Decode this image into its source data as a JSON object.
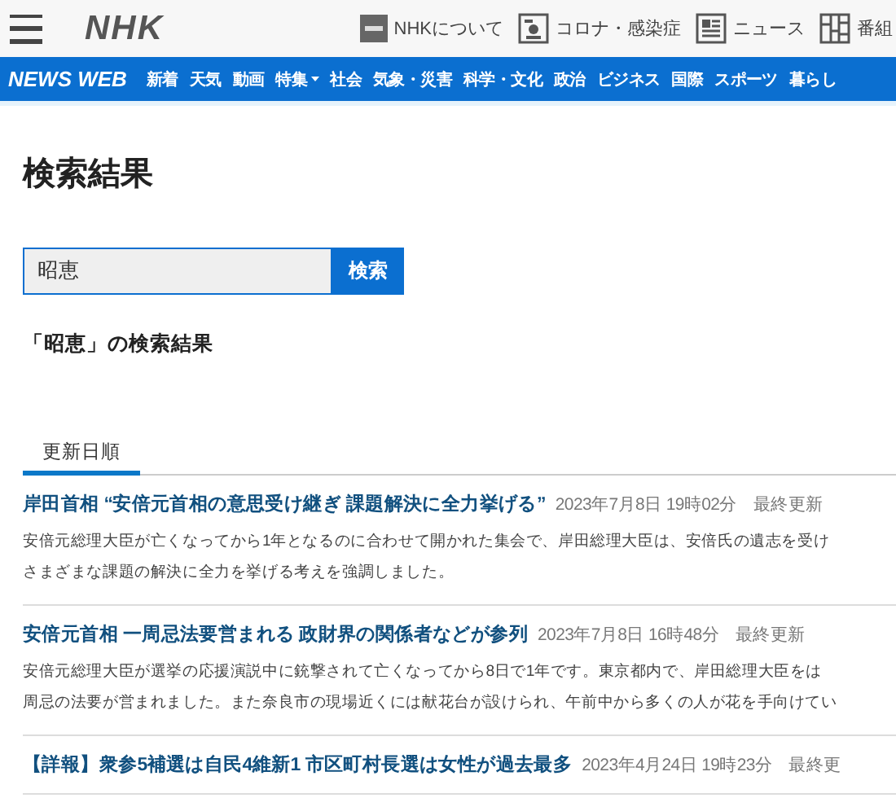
{
  "header": {
    "logo": "NHK",
    "links": [
      {
        "kind": "about",
        "label": "NHKについて"
      },
      {
        "kind": "corona",
        "label": "コロナ・感染症"
      },
      {
        "kind": "news",
        "label": "ニュース"
      },
      {
        "kind": "schedule",
        "label": "番組"
      }
    ]
  },
  "nav": {
    "brand": "NEWS WEB",
    "items": [
      {
        "label": "新着",
        "dropdown": false
      },
      {
        "label": "天気",
        "dropdown": false
      },
      {
        "label": "動画",
        "dropdown": false
      },
      {
        "label": "特集",
        "dropdown": true
      },
      {
        "label": "社会",
        "dropdown": false
      },
      {
        "label": "気象・災害",
        "dropdown": false
      },
      {
        "label": "科学・文化",
        "dropdown": false
      },
      {
        "label": "政治",
        "dropdown": false
      },
      {
        "label": "ビジネス",
        "dropdown": false
      },
      {
        "label": "国際",
        "dropdown": false
      },
      {
        "label": "スポーツ",
        "dropdown": false
      },
      {
        "label": "暮らし",
        "dropdown": false
      }
    ]
  },
  "page_title": "検索結果",
  "search": {
    "value": "昭恵",
    "button": "検索"
  },
  "results_heading": "「昭恵」の検索結果",
  "tabs": [
    {
      "label": "更新日順",
      "selected": true
    }
  ],
  "results": [
    {
      "title": "岸田首相 “安倍元首相の意思受け継ぎ 課題解決に全力挙げる”",
      "date": "2023年7月8日 19時02分",
      "note": "最終更新",
      "summary_lines": [
        "安倍元総理大臣が亡くなってから1年となるのに合わせて開かれた集会で、岸田総理大臣は、安倍氏の遺志を受け",
        "さまざまな課題の解決に全力を挙げる考えを強調しました。"
      ]
    },
    {
      "title": "安倍元首相 一周忌法要営まれる 政財界の関係者などが参列",
      "date": "2023年7月8日 16時48分",
      "note": "最終更新",
      "summary_lines": [
        "安倍元総理大臣が選挙の応援演説中に銃撃されて亡くなってから8日で1年です。東京都内で、岸田総理大臣をは",
        "周忌の法要が営まれました。また奈良市の現場近くには献花台が設けられ、午前中から多くの人が花を手向けてい"
      ]
    },
    {
      "title": "【詳報】衆参5補選は自民4維新1 市区町村長選は女性が過去最多",
      "date": "2023年4月24日 19時23分",
      "note": "最終更"
    }
  ]
}
